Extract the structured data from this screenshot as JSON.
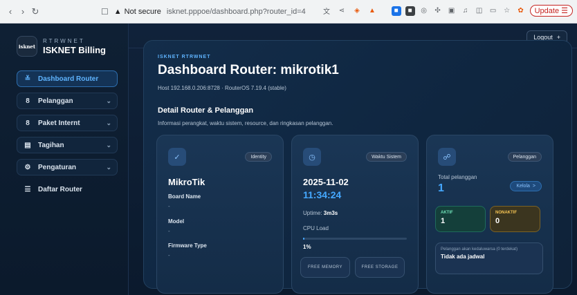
{
  "browser": {
    "back_icon": "chevron-left-icon",
    "forward_icon": "chevron-right-icon",
    "reload_icon": "reload-icon",
    "security_label": "Not secure",
    "url": "isknet.pppoe/dashboard.php?router_id=4",
    "update_label": "Update"
  },
  "brand": {
    "logo_text": "isknet",
    "subtitle": "RTRWNET",
    "title": "ISKNET Billing"
  },
  "sidebar": {
    "items": [
      {
        "label": "Dashboard Router",
        "icon": "router-icon",
        "glyph": "≚",
        "active": true,
        "chevron": false
      },
      {
        "label": "Pelanggan",
        "icon": "user-icon",
        "glyph": "8",
        "active": false,
        "chevron": true
      },
      {
        "label": "Paket Internt",
        "icon": "package-icon",
        "glyph": "8",
        "active": false,
        "chevron": true
      },
      {
        "label": "Tagihan",
        "icon": "invoice-icon",
        "glyph": "▤",
        "active": false,
        "chevron": true
      },
      {
        "label": "Pengaturan",
        "icon": "gear-icon",
        "glyph": "⚙",
        "active": false,
        "chevron": true
      },
      {
        "label": "Daftar Router",
        "icon": "list-icon",
        "glyph": "☰",
        "active": false,
        "chevron": false
      }
    ]
  },
  "topbar": {
    "logout_label": "Logout",
    "logout_icon": "+"
  },
  "main": {
    "crumb": "ISKNET RTRWNET",
    "title": "Dashboard Router: mikrotik1",
    "host": "Host 192.168.0.206:8728 · RouterOS 7.19.4 (stable)",
    "section_title": "Detail Router & Pelanggan",
    "section_desc": "Informasi perangkat, waktu sistem, resource, dan ringkasan pelanggan."
  },
  "card_identity": {
    "pill": "Identity",
    "icon": "check-icon",
    "name": "MikroTik",
    "fields": [
      {
        "label": "Board Name",
        "value": "-"
      },
      {
        "label": "Model",
        "value": "-"
      },
      {
        "label": "Firmware Type",
        "value": "-"
      }
    ]
  },
  "card_time": {
    "pill": "Waktu Sistem",
    "icon": "clock-icon",
    "date": "2025-11-02",
    "time": "11:34:24",
    "uptime_label": "Uptime:",
    "uptime_value": "3m3s",
    "cpu_label": "CPU Load",
    "cpu_value": "1%",
    "cpu_percent": 1,
    "free_memory_label": "FREE MEMORY",
    "free_storage_label": "FREE STORAGE"
  },
  "card_customers": {
    "pill": "Pelanggan",
    "icon": "users-icon",
    "total_label": "Total pelanggan",
    "total_value": "1",
    "manage_label": "Kelola",
    "manage_icon": ">",
    "active_label": "AKTIF",
    "active_value": "1",
    "inactive_label": "NONAKTIF",
    "inactive_value": "0",
    "expiring_label": "Pelanggan akan kedaluwarsa (0 terdekat)",
    "expiring_value": "Tidak ada jadwal"
  },
  "colors": {
    "accent": "#45a8ff",
    "background": "#0d1b2e",
    "active_green": "#6fe0b7",
    "inactive_amber": "#f6c453"
  }
}
